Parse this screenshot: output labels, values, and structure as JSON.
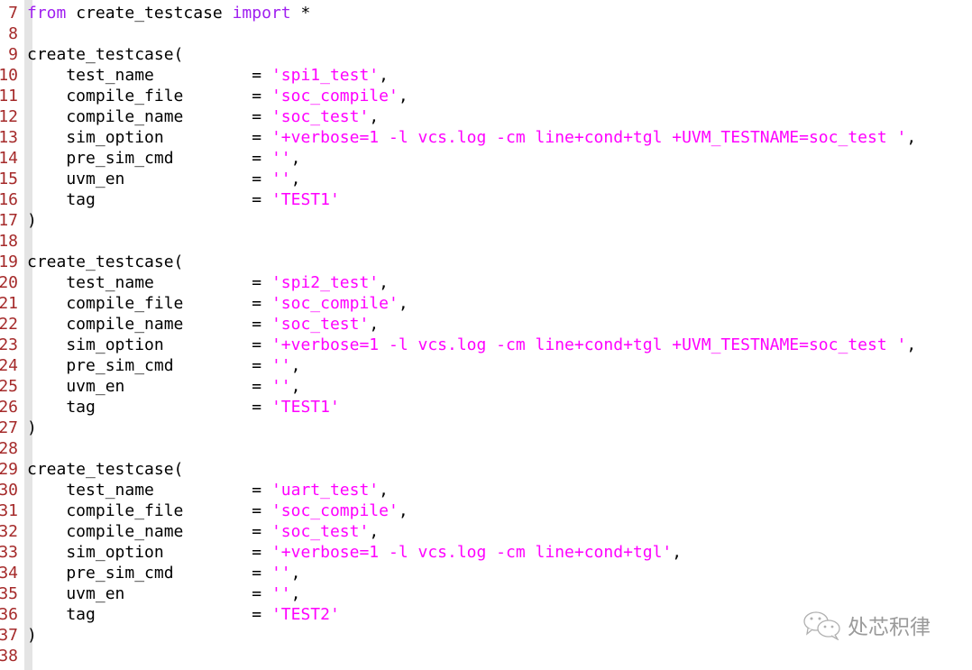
{
  "colors": {
    "default": "#000000",
    "keyword": "#a020f0",
    "string": "#ff00ff",
    "line_number": "#a52a2a"
  },
  "lines": [
    {
      "num": "7",
      "tokens": [
        {
          "t": "from",
          "c": "keyword"
        },
        {
          "t": " create_testcase ",
          "c": "default"
        },
        {
          "t": "import",
          "c": "keyword"
        },
        {
          "t": " *",
          "c": "default"
        }
      ]
    },
    {
      "num": "8",
      "tokens": []
    },
    {
      "num": "9",
      "tokens": [
        {
          "t": "create_testcase(",
          "c": "default"
        }
      ]
    },
    {
      "num": "10",
      "tokens": [
        {
          "t": "    test_name          = ",
          "c": "default"
        },
        {
          "t": "'spi1_test'",
          "c": "string"
        },
        {
          "t": ",",
          "c": "default"
        }
      ]
    },
    {
      "num": "11",
      "tokens": [
        {
          "t": "    compile_file       = ",
          "c": "default"
        },
        {
          "t": "'soc_compile'",
          "c": "string"
        },
        {
          "t": ",",
          "c": "default"
        }
      ]
    },
    {
      "num": "12",
      "tokens": [
        {
          "t": "    compile_name       = ",
          "c": "default"
        },
        {
          "t": "'soc_test'",
          "c": "string"
        },
        {
          "t": ",",
          "c": "default"
        }
      ]
    },
    {
      "num": "13",
      "tokens": [
        {
          "t": "    sim_option         = ",
          "c": "default"
        },
        {
          "t": "'+verbose=1 -l vcs.log -cm line+cond+tgl +UVM_TESTNAME=soc_test '",
          "c": "string"
        },
        {
          "t": ",",
          "c": "default"
        }
      ]
    },
    {
      "num": "14",
      "tokens": [
        {
          "t": "    pre_sim_cmd        = ",
          "c": "default"
        },
        {
          "t": "''",
          "c": "string"
        },
        {
          "t": ",",
          "c": "default"
        }
      ]
    },
    {
      "num": "15",
      "tokens": [
        {
          "t": "    uvm_en             = ",
          "c": "default"
        },
        {
          "t": "''",
          "c": "string"
        },
        {
          "t": ",",
          "c": "default"
        }
      ]
    },
    {
      "num": "16",
      "tokens": [
        {
          "t": "    tag                = ",
          "c": "default"
        },
        {
          "t": "'TEST1'",
          "c": "string"
        }
      ]
    },
    {
      "num": "17",
      "tokens": [
        {
          "t": ")",
          "c": "default"
        }
      ]
    },
    {
      "num": "18",
      "tokens": []
    },
    {
      "num": "19",
      "tokens": [
        {
          "t": "create_testcase(",
          "c": "default"
        }
      ]
    },
    {
      "num": "20",
      "tokens": [
        {
          "t": "    test_name          = ",
          "c": "default"
        },
        {
          "t": "'spi2_test'",
          "c": "string"
        },
        {
          "t": ",",
          "c": "default"
        }
      ]
    },
    {
      "num": "21",
      "tokens": [
        {
          "t": "    compile_file       = ",
          "c": "default"
        },
        {
          "t": "'soc_compile'",
          "c": "string"
        },
        {
          "t": ",",
          "c": "default"
        }
      ]
    },
    {
      "num": "22",
      "tokens": [
        {
          "t": "    compile_name       = ",
          "c": "default"
        },
        {
          "t": "'soc_test'",
          "c": "string"
        },
        {
          "t": ",",
          "c": "default"
        }
      ]
    },
    {
      "num": "23",
      "tokens": [
        {
          "t": "    sim_option         = ",
          "c": "default"
        },
        {
          "t": "'+verbose=1 -l vcs.log -cm line+cond+tgl +UVM_TESTNAME=soc_test '",
          "c": "string"
        },
        {
          "t": ",",
          "c": "default"
        }
      ]
    },
    {
      "num": "24",
      "tokens": [
        {
          "t": "    pre_sim_cmd        = ",
          "c": "default"
        },
        {
          "t": "''",
          "c": "string"
        },
        {
          "t": ",",
          "c": "default"
        }
      ]
    },
    {
      "num": "25",
      "tokens": [
        {
          "t": "    uvm_en             = ",
          "c": "default"
        },
        {
          "t": "''",
          "c": "string"
        },
        {
          "t": ",",
          "c": "default"
        }
      ]
    },
    {
      "num": "26",
      "tokens": [
        {
          "t": "    tag                = ",
          "c": "default"
        },
        {
          "t": "'TEST1'",
          "c": "string"
        }
      ]
    },
    {
      "num": "27",
      "tokens": [
        {
          "t": ")",
          "c": "default"
        }
      ]
    },
    {
      "num": "28",
      "tokens": []
    },
    {
      "num": "29",
      "tokens": [
        {
          "t": "create_testcase(",
          "c": "default"
        }
      ]
    },
    {
      "num": "30",
      "tokens": [
        {
          "t": "    test_name          = ",
          "c": "default"
        },
        {
          "t": "'uart_test'",
          "c": "string"
        },
        {
          "t": ",",
          "c": "default"
        }
      ]
    },
    {
      "num": "31",
      "tokens": [
        {
          "t": "    compile_file       = ",
          "c": "default"
        },
        {
          "t": "'soc_compile'",
          "c": "string"
        },
        {
          "t": ",",
          "c": "default"
        }
      ]
    },
    {
      "num": "32",
      "tokens": [
        {
          "t": "    compile_name       = ",
          "c": "default"
        },
        {
          "t": "'soc_test'",
          "c": "string"
        },
        {
          "t": ",",
          "c": "default"
        }
      ]
    },
    {
      "num": "33",
      "tokens": [
        {
          "t": "    sim_option         = ",
          "c": "default"
        },
        {
          "t": "'+verbose=1 -l vcs.log -cm line+cond+tgl'",
          "c": "string"
        },
        {
          "t": ",",
          "c": "default"
        }
      ]
    },
    {
      "num": "34",
      "tokens": [
        {
          "t": "    pre_sim_cmd        = ",
          "c": "default"
        },
        {
          "t": "''",
          "c": "string"
        },
        {
          "t": ",",
          "c": "default"
        }
      ]
    },
    {
      "num": "35",
      "tokens": [
        {
          "t": "    uvm_en             = ",
          "c": "default"
        },
        {
          "t": "''",
          "c": "string"
        },
        {
          "t": ",",
          "c": "default"
        }
      ]
    },
    {
      "num": "36",
      "tokens": [
        {
          "t": "    tag                = ",
          "c": "default"
        },
        {
          "t": "'TEST2'",
          "c": "string"
        }
      ]
    },
    {
      "num": "37",
      "tokens": [
        {
          "t": ")",
          "c": "default"
        }
      ]
    },
    {
      "num": "38",
      "tokens": []
    }
  ],
  "watermark": {
    "icon": "wechat-icon",
    "text": "处芯积律"
  }
}
